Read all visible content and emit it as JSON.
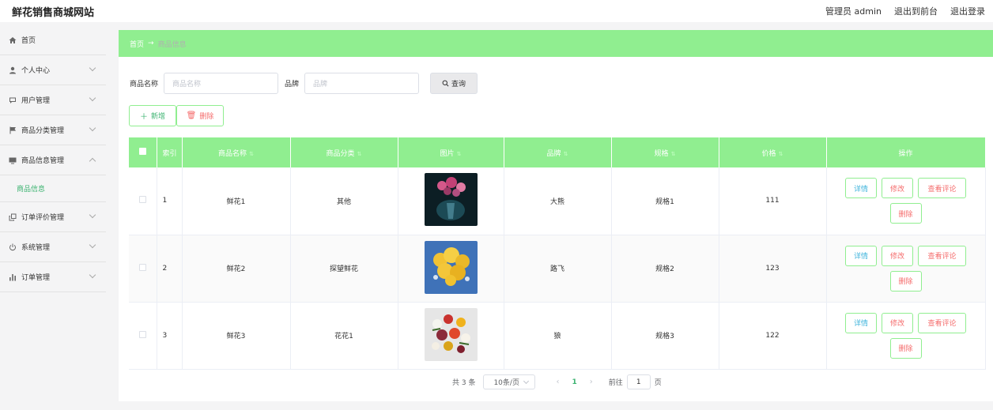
{
  "header": {
    "site_title": "鲜花销售商城网站",
    "admin": "管理员 admin",
    "to_front": "退出到前台",
    "logout": "退出登录"
  },
  "sidebar": {
    "items": [
      {
        "label": "首页",
        "icon": "home-icon"
      },
      {
        "label": "个人中心",
        "icon": "user-icon"
      },
      {
        "label": "用户管理",
        "icon": "chat-icon"
      },
      {
        "label": "商品分类管理",
        "icon": "flag-icon"
      },
      {
        "label": "商品信息管理",
        "icon": "monitor-icon"
      },
      {
        "label": "订单评价管理",
        "icon": "copy-icon"
      },
      {
        "label": "系统管理",
        "icon": "power-icon"
      },
      {
        "label": "订单管理",
        "icon": "bar-chart-icon"
      }
    ],
    "active_sub": "商品信息"
  },
  "breadcrumb": {
    "home": "首页",
    "sep": "→",
    "current": "商品信息"
  },
  "filters": {
    "name_label": "商品名称",
    "name_placeholder": "商品名称",
    "brand_label": "品牌",
    "brand_placeholder": "品牌",
    "query": "查询"
  },
  "actions": {
    "add": "新增",
    "delete": "删除"
  },
  "table": {
    "headers": {
      "index": "索引",
      "name": "商品名称",
      "category": "商品分类",
      "image": "图片",
      "brand": "品牌",
      "spec": "规格",
      "price": "价格",
      "ops": "操作"
    },
    "rows": [
      {
        "index": "1",
        "name": "鲜花1",
        "category": "其他",
        "brand": "大熊",
        "spec": "规格1",
        "price": "111"
      },
      {
        "index": "2",
        "name": "鲜花2",
        "category": "探望鲜花",
        "brand": "路飞",
        "spec": "规格2",
        "price": "123"
      },
      {
        "index": "3",
        "name": "鲜花3",
        "category": "花花1",
        "brand": "狼",
        "spec": "规格3",
        "price": "122"
      }
    ],
    "ops": {
      "detail": "详情",
      "edit": "修改",
      "comment": "查看评论",
      "delete": "删除"
    }
  },
  "pager": {
    "total": "共 3 条",
    "size": "10条/页",
    "prev": "‹",
    "page": "1",
    "next": "›",
    "goto": "前往",
    "goto_value": "1",
    "unit": "页"
  },
  "colors": {
    "accent": "#90ee90",
    "active_text": "#3cb371",
    "danger": "#f56c6c",
    "info": "#40b4dc"
  }
}
